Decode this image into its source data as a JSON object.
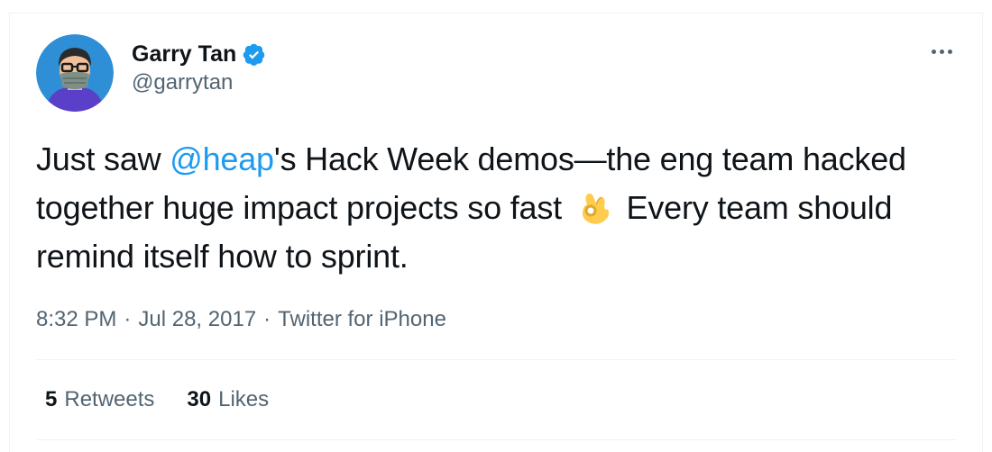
{
  "author": {
    "name": "Garry Tan",
    "handle": "@garrytan",
    "verified": true
  },
  "tweet": {
    "text_before": "Just saw ",
    "mention": "@heap",
    "text_after_mention": "'s Hack Week demos—the eng team hacked together huge impact projects so fast ",
    "emoji": "ok-hand",
    "text_end": " Every team should remind itself how to sprint."
  },
  "meta": {
    "time": "8:32 PM",
    "separator": "·",
    "date": "Jul 28, 2017",
    "source": "Twitter for iPhone"
  },
  "stats": {
    "retweets_count": "5",
    "retweets_label": "Retweets",
    "likes_count": "30",
    "likes_label": "Likes"
  },
  "colors": {
    "accent": "#1d9bf0",
    "secondary_text": "#536471",
    "primary_text": "#0f1419",
    "divider": "#eff3f4"
  },
  "icons": {
    "verified": "verified-badge-icon",
    "more": "more-horizontal-icon",
    "emoji": "ok-hand-emoji-icon"
  }
}
